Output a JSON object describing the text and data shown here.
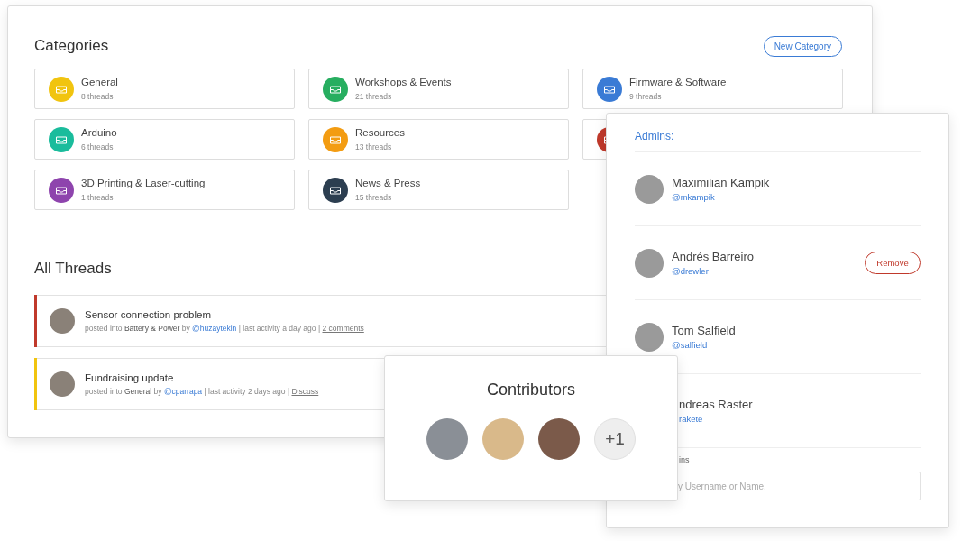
{
  "categories_panel": {
    "title": "Categories",
    "new_button": "New Category",
    "categories": [
      {
        "name": "General",
        "count": "8 threads",
        "color": "#f1c40f"
      },
      {
        "name": "Workshops & Events",
        "count": "21 threads",
        "color": "#27ae60"
      },
      {
        "name": "Firmware & Software",
        "count": "9 threads",
        "color": "#3a7bd5"
      },
      {
        "name": "Arduino",
        "count": "6 threads",
        "color": "#1abc9c"
      },
      {
        "name": "Resources",
        "count": "13 threads",
        "color": "#f39c12"
      },
      {
        "color": "#c0392b"
      },
      {
        "name": "3D Printing & Laser-cutting",
        "count": "1 threads",
        "color": "#8e44ad"
      },
      {
        "name": "News & Press",
        "count": "15 threads",
        "color": "#2c3e50"
      }
    ]
  },
  "threads_panel": {
    "title": "All Threads",
    "threads": [
      {
        "title": "Sensor connection problem",
        "color": "#c0392b",
        "prefix": "posted into",
        "category": "Battery & Power",
        "by": "by",
        "author": "@huzaytekin",
        "activity": "| last activity a day ago |",
        "link": "2 comments"
      },
      {
        "title": "Fundraising update",
        "color": "#f1c40f",
        "prefix": "posted into",
        "category": "General",
        "by": "by",
        "author": "@cparrapa",
        "activity": "| last activity 2 days ago |",
        "link": "Discuss"
      }
    ]
  },
  "admins_panel": {
    "title": "Admins:",
    "admins": [
      {
        "name": "Maximilian Kampik",
        "handle": "@mkampik",
        "avatar_visible": true
      },
      {
        "name": "Andrés Barreiro",
        "handle": "@drewler",
        "avatar_visible": true,
        "remove_button": "Remove"
      },
      {
        "name": "Tom Salfield",
        "handle": "@salfield",
        "avatar_visible": true
      },
      {
        "name": "ndreas Raster",
        "handle": "rakete",
        "avatar_visible": false
      }
    ],
    "add_label": "ins",
    "add_field": {
      "placeholder": "y Username or Name."
    }
  },
  "contributors_panel": {
    "title": "Contributors",
    "more": "+1"
  }
}
